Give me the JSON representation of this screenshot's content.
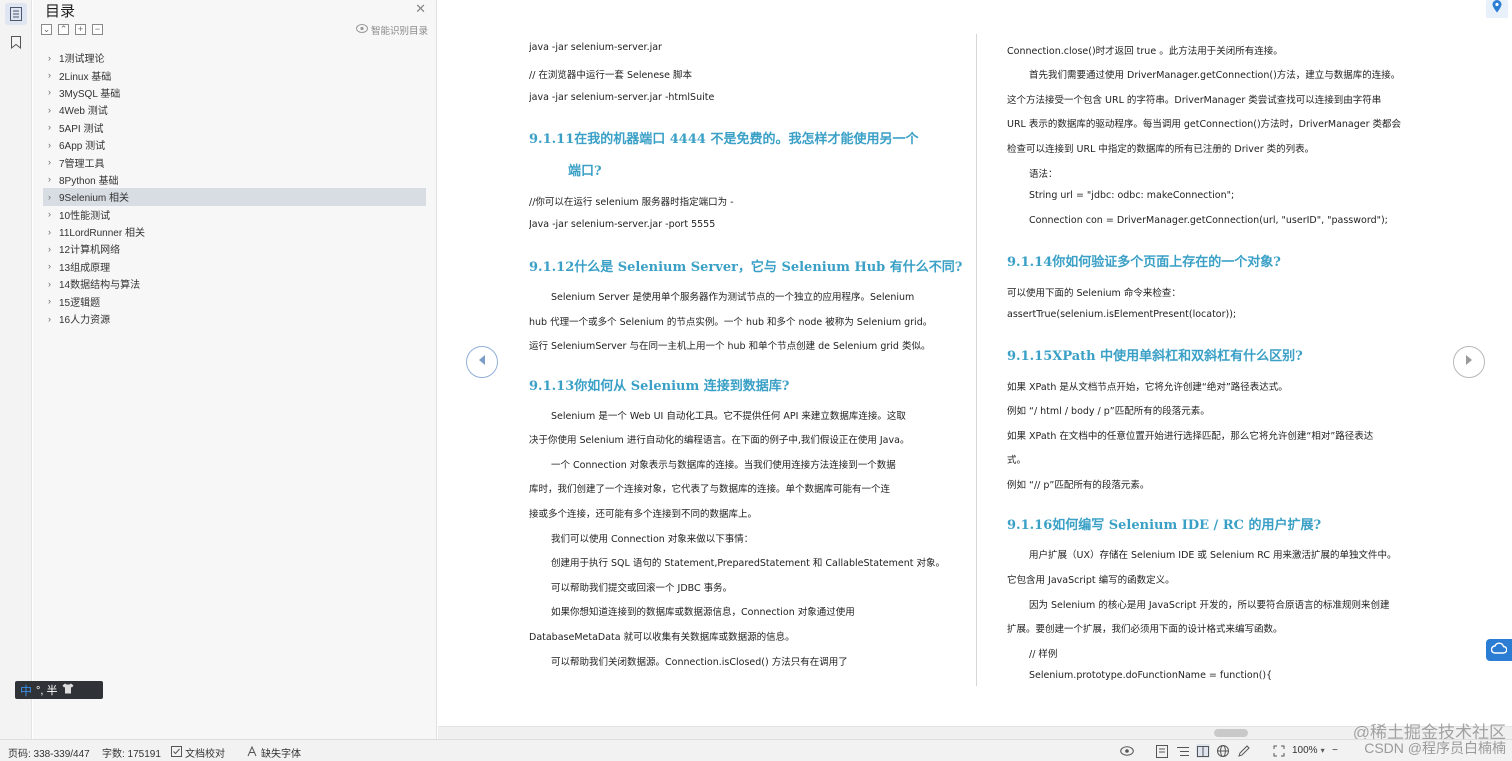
{
  "toc": {
    "title": "目录",
    "smart_label": "智能识别目录",
    "items": [
      {
        "label": "1测试理论"
      },
      {
        "label": "2Linux 基础"
      },
      {
        "label": "3MySQL 基础"
      },
      {
        "label": "4Web 测试"
      },
      {
        "label": "5API 测试"
      },
      {
        "label": "6App 测试"
      },
      {
        "label": "7管理工具"
      },
      {
        "label": "8Python 基础"
      },
      {
        "label": "9Selenium 相关"
      },
      {
        "label": "10性能测试"
      },
      {
        "label": "11LordRunner 相关"
      },
      {
        "label": "12计算机网络"
      },
      {
        "label": "13组成原理"
      },
      {
        "label": "14数据结构与算法"
      },
      {
        "label": "15逻辑题"
      },
      {
        "label": "16人力资源"
      }
    ],
    "selected_index": 8
  },
  "ime": {
    "mode": "中",
    "punct": "°, 半"
  },
  "doc": {
    "col1": [
      "java -jar selenium-server.jar",
      "//  在浏览器中运行一套 Selenese 脚本",
      "java -jar selenium-server.jar -htmlSuite",
      "9.1.11在我的机器端口 4444 不是免费的。我怎样才能使用另一个",
      "端口?",
      "//你可以在运行 selenium 服务器时指定端口为  -",
      "Java -jar selenium-server.jar -port 5555",
      "9.1.12什么是 Selenium Server，它与 Selenium Hub 有什么不同?",
      "Selenium Server 是使用单个服务器作为测试节点的一个独立的应用程序。Selenium",
      "hub 代理一个或多个 Selenium 的节点实例。一个 hub  和多个 node 被称为 Selenium grid。",
      "运行 SeleniumServer 与在同一主机上用一个 hub 和单个节点创建 de Selenium grid 类似。",
      "9.1.13你如何从 Selenium 连接到数据库?",
      "Selenium 是一个 Web UI 自动化工具。它不提供任何 API 来建立数据库连接。这取",
      "决于你使用 Selenium 进行自动化的编程语言。在下面的例子中,我们假设正在使用 Java。",
      "一个 Connection 对象表示与数据库的连接。当我们使用连接方法连接到一个数据",
      "库时，我们创建了一个连接对象，它代表了与数据库的连接。单个数据库可能有一个连",
      "接或多个连接，还可能有多个连接到不同的数据库上。",
      "我们可以使用 Connection 对象来做以下事情：",
      "创建用于执行 SQL 语句的 Statement,PreparedStatement 和 CallableStatement 对象。",
      "可以帮助我们提交或回滚一个 JDBC 事务。",
      "如果你想知道连接到的数据库或数据源信息，Connection 对象通过使用",
      "DatabaseMetaData 就可以收集有关数据库或数据源的信息。",
      "可以帮助我们关闭数据源。Connection.isClosed()  方法只有在调用了"
    ],
    "col2": [
      "Connection.close()时才返回 true 。此方法用于关闭所有连接。",
      "首先我们需要通过使用 DriverManager.getConnection()方法，建立与数据库的连接。",
      "这个方法接受一个包含 URL 的字符串。DriverManager 类尝试查找可以连接到由字符串",
      "URL 表示的数据库的驱动程序。每当调用 getConnection()方法时，DriverManager 类都会",
      "检查可以连接到 URL 中指定的数据库的所有已注册的 Driver 类的列表。",
      "语法：",
      "String url = \"jdbc: odbc: makeConnection\";",
      "Connection con = DriverManager.getConnection(url, \"userID\", \"password\");",
      "9.1.14你如何验证多个页面上存在的一个对象?",
      "可以使用下面的 Selenium 命令来检查：",
      "assertTrue(selenium.isElementPresent(locator));",
      "9.1.15XPath 中使用单斜杠和双斜杠有什么区别?",
      "如果 XPath 是从文档节点开始，它将允许创建“绝对”路径表达式。",
      "例如 “/ html / body / p”匹配所有的段落元素。",
      "如果 XPath 在文档中的任意位置开始进行选择匹配，那么它将允许创建“相对”路径表达",
      "式。",
      "例如 “// p”匹配所有的段落元素。",
      "9.1.16如何编写 Selenium IDE / RC 的用户扩展?",
      "用户扩展（UX）存储在 Selenium IDE 或 Selenium RC 用来激活扩展的单独文件中。",
      "它包含用 JavaScript 编写的函数定义。",
      "因为 Selenium 的核心是用 JavaScript 开发的，所以要符合原语言的标准规则来创建",
      "扩展。要创建一个扩展，我们必须用下面的设计格式来编写函数。",
      "// 样例",
      "Selenium.prototype.doFunctionName = function(){"
    ]
  },
  "watermark": "@稀土掘金技术社区",
  "watermark2": "CSDN @程序员白楠楠",
  "status": {
    "pages": "页码: 338-339/447",
    "words": "字数: 175191",
    "proof": "文档校对",
    "missing_font": "缺失字体",
    "zoom": "100%"
  }
}
